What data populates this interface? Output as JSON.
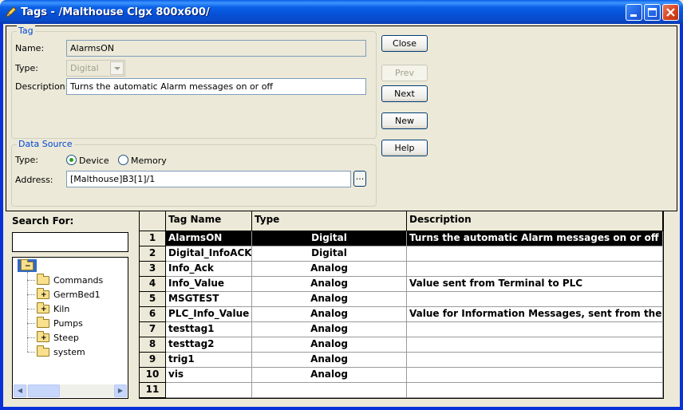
{
  "window": {
    "title": "Tags - /Malthouse Clgx 800x600/"
  },
  "tag_group": {
    "legend": "Tag",
    "name_label": "Name:",
    "name_value": "AlarmsON",
    "type_label": "Type:",
    "type_value": "Digital",
    "description_label": "Description:",
    "description_value": "Turns the automatic Alarm messages on or off"
  },
  "data_source": {
    "legend": "Data Source",
    "type_label": "Type:",
    "device_label": "Device",
    "memory_label": "Memory",
    "selected": "Device",
    "address_label": "Address:",
    "address_value": "[Malthouse]B3[1]/1",
    "browse_label": "..."
  },
  "buttons": {
    "close": "Close",
    "prev": "Prev",
    "next": "Next",
    "new": "New",
    "help": "Help"
  },
  "search": {
    "label": "Search For:",
    "value": "",
    "tree": [
      {
        "label": "Commands",
        "expandable": false
      },
      {
        "label": "GermBed1",
        "expandable": true
      },
      {
        "label": "Kiln",
        "expandable": true
      },
      {
        "label": "Pumps",
        "expandable": false
      },
      {
        "label": "Steep",
        "expandable": true
      },
      {
        "label": "system",
        "expandable": false
      }
    ]
  },
  "grid": {
    "columns": [
      "Tag Name",
      "Type",
      "Description"
    ],
    "selected_row": 1,
    "rows": [
      {
        "num": "1",
        "name": "AlarmsON",
        "type": "Digital",
        "desc": "Turns the automatic Alarm messages on or off"
      },
      {
        "num": "2",
        "name": "Digital_InfoACK",
        "type": "Digital",
        "desc": ""
      },
      {
        "num": "3",
        "name": "Info_Ack",
        "type": "Analog",
        "desc": ""
      },
      {
        "num": "4",
        "name": "Info_Value",
        "type": "Analog",
        "desc": "Value sent from Terminal to PLC"
      },
      {
        "num": "5",
        "name": "MSGTEST",
        "type": "Analog",
        "desc": ""
      },
      {
        "num": "6",
        "name": "PLC_Info_Value",
        "type": "Analog",
        "desc": "Value for Information Messages, sent from the PL"
      },
      {
        "num": "7",
        "name": "testtag1",
        "type": "Analog",
        "desc": ""
      },
      {
        "num": "8",
        "name": "testtag2",
        "type": "Analog",
        "desc": ""
      },
      {
        "num": "9",
        "name": "trig1",
        "type": "Analog",
        "desc": ""
      },
      {
        "num": "10",
        "name": "vis",
        "type": "Analog",
        "desc": ""
      },
      {
        "num": "11",
        "name": "",
        "type": "",
        "desc": ""
      }
    ]
  }
}
